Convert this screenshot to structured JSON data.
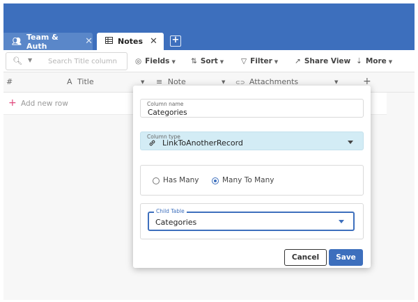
{
  "tabs": [
    {
      "label": "Team & Auth",
      "icon": "team-icon"
    },
    {
      "label": "Notes",
      "icon": "table-icon"
    }
  ],
  "toolbar": {
    "search_placeholder": "Search Title column",
    "fields_label": "Fields",
    "sort_label": "Sort",
    "filter_label": "Filter",
    "share_label": "Share View",
    "more_label": "More"
  },
  "grid": {
    "columns": [
      {
        "label": "#"
      },
      {
        "label": "Title",
        "type_glyph": "A"
      },
      {
        "label": "Note",
        "type_glyph": "≡"
      },
      {
        "label": "Attachments",
        "type_glyph": "⊂⊃"
      }
    ],
    "add_column_glyph": "+",
    "add_row_label": "Add new row"
  },
  "modal": {
    "column_name_label": "Column name",
    "column_name_value": "Categories",
    "column_type_label": "Column type",
    "column_type_value": "LinkToAnotherRecord",
    "relation_options": [
      {
        "label": "Has Many",
        "selected": false
      },
      {
        "label": "Many To Many",
        "selected": true
      }
    ],
    "child_table_label": "Child Table",
    "child_table_value": "Categories",
    "cancel_label": "Cancel",
    "save_label": "Save"
  },
  "colors": {
    "header_blue": "#3d6fbd",
    "inactive_tab": "#5a87c9",
    "link_type_bg": "#d3ecf5",
    "add_row_plus": "#e0457b"
  }
}
